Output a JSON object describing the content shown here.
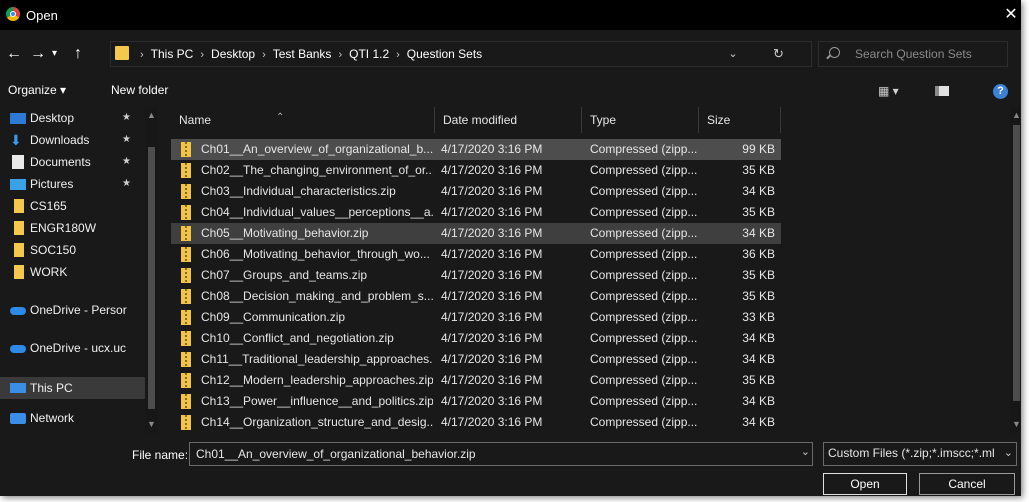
{
  "window": {
    "title": "Open",
    "close_glyph": "✕"
  },
  "address": {
    "crumbs": [
      "This PC",
      "Desktop",
      "Test Banks",
      "QTI 1.2",
      "Question Sets"
    ],
    "search_placeholder": "Search Question Sets"
  },
  "toolbar": {
    "organize": "Organize ▾",
    "new_folder": "New folder",
    "help": "?"
  },
  "nav": {
    "items": [
      {
        "label": "Desktop",
        "icon": "desktop-icon",
        "pinned": true
      },
      {
        "label": "Downloads",
        "icon": "downloads-icon",
        "pinned": true
      },
      {
        "label": "Documents",
        "icon": "documents-icon",
        "pinned": true
      },
      {
        "label": "Pictures",
        "icon": "pictures-icon",
        "pinned": true
      },
      {
        "label": "CS165",
        "icon": "folder-icon"
      },
      {
        "label": "ENGR180W",
        "icon": "folder-icon"
      },
      {
        "label": "SOC150",
        "icon": "folder-icon"
      },
      {
        "label": "WORK",
        "icon": "folder-icon"
      },
      {
        "label": "OneDrive - Persor",
        "icon": "onedrive-icon"
      },
      {
        "label": "OneDrive - ucx.uc",
        "icon": "onedrive-icon"
      },
      {
        "label": "This PC",
        "icon": "this-pc-icon",
        "selected": true
      },
      {
        "label": "Network",
        "icon": "network-icon"
      }
    ]
  },
  "columns": {
    "name": "Name",
    "date": "Date modified",
    "type": "Type",
    "size": "Size"
  },
  "files": [
    {
      "name": "Ch01__An_overview_of_organizational_b...",
      "date": "4/17/2020 3:16 PM",
      "type": "Compressed (zipp...",
      "size": "99 KB",
      "selected": true
    },
    {
      "name": "Ch02__The_changing_environment_of_or...",
      "date": "4/17/2020 3:16 PM",
      "type": "Compressed (zipp...",
      "size": "35 KB"
    },
    {
      "name": "Ch03__Individual_characteristics.zip",
      "date": "4/17/2020 3:16 PM",
      "type": "Compressed (zipp...",
      "size": "34 KB"
    },
    {
      "name": "Ch04__Individual_values__perceptions__a...",
      "date": "4/17/2020 3:16 PM",
      "type": "Compressed (zipp...",
      "size": "35 KB"
    },
    {
      "name": "Ch05__Motivating_behavior.zip",
      "date": "4/17/2020 3:16 PM",
      "type": "Compressed (zipp...",
      "size": "34 KB",
      "hover": true
    },
    {
      "name": "Ch06__Motivating_behavior_through_wo...",
      "date": "4/17/2020 3:16 PM",
      "type": "Compressed (zipp...",
      "size": "36 KB"
    },
    {
      "name": "Ch07__Groups_and_teams.zip",
      "date": "4/17/2020 3:16 PM",
      "type": "Compressed (zipp...",
      "size": "35 KB"
    },
    {
      "name": "Ch08__Decision_making_and_problem_s...",
      "date": "4/17/2020 3:16 PM",
      "type": "Compressed (zipp...",
      "size": "35 KB"
    },
    {
      "name": "Ch09__Communication.zip",
      "date": "4/17/2020 3:16 PM",
      "type": "Compressed (zipp...",
      "size": "33 KB"
    },
    {
      "name": "Ch10__Conflict_and_negotiation.zip",
      "date": "4/17/2020 3:16 PM",
      "type": "Compressed (zipp...",
      "size": "34 KB"
    },
    {
      "name": "Ch11__Traditional_leadership_approaches...",
      "date": "4/17/2020 3:16 PM",
      "type": "Compressed (zipp...",
      "size": "34 KB"
    },
    {
      "name": "Ch12__Modern_leadership_approaches.zip",
      "date": "4/17/2020 3:16 PM",
      "type": "Compressed (zipp...",
      "size": "35 KB"
    },
    {
      "name": "Ch13__Power__influence__and_politics.zip",
      "date": "4/17/2020 3:16 PM",
      "type": "Compressed (zipp...",
      "size": "34 KB"
    },
    {
      "name": "Ch14__Organization_structure_and_desig...",
      "date": "4/17/2020 3:16 PM",
      "type": "Compressed (zipp...",
      "size": "34 KB"
    }
  ],
  "filename": {
    "label": "File name:",
    "value": "Ch01__An_overview_of_organizational_behavior.zip"
  },
  "filetype": {
    "label": "Custom Files (*.zip;*.imscc;*.ml"
  },
  "buttons": {
    "open": "Open",
    "cancel": "Cancel"
  },
  "colors": {
    "selected_row": "#4d4d4d",
    "hover_row": "#3f3f3f",
    "folder": "#f3c84d",
    "help": "#3b82d6"
  }
}
